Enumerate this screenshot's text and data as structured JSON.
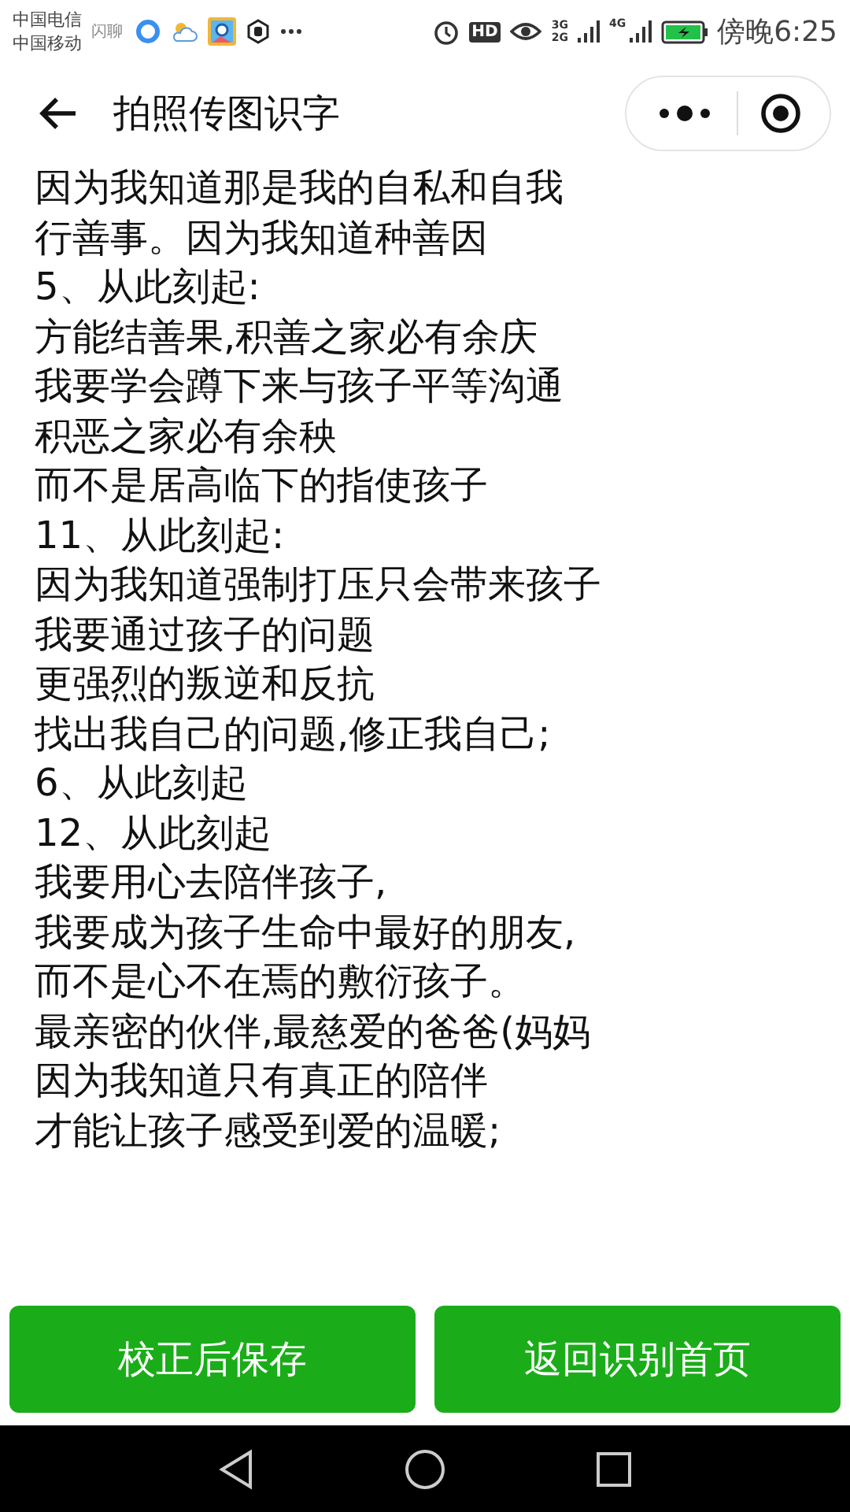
{
  "status_bar": {
    "carriers": [
      "中国电信",
      "中国移动"
    ],
    "app_label": "闪聊",
    "network_labels": [
      "3G",
      "2G",
      "4G"
    ],
    "hd": "HD",
    "time": "傍晚6:25"
  },
  "nav": {
    "title": "拍照传图识字"
  },
  "lines": [
    "因为我知道那是我的自私和自我",
    "行善事。因为我知道种善因",
    "5、从此刻起:",
    "方能结善果,积善之家必有余庆",
    "我要学会蹲下来与孩子平等沟通",
    "积恶之家必有余秧",
    "而不是居高临下的指使孩子",
    "11、从此刻起:",
    "因为我知道强制打压只会带来孩子",
    "我要通过孩子的问题",
    "更强烈的叛逆和反抗",
    "找出我自己的问题,修正我自己;",
    "6、从此刻起",
    "12、从此刻起",
    "我要用心去陪伴孩子,",
    "我要成为孩子生命中最好的朋友,",
    "而不是心不在焉的敷衍孩子。",
    "最亲密的伙伴,最慈爱的爸爸(妈妈",
    "因为我知道只有真正的陪伴",
    "才能让孩子感受到爱的温暖;"
  ],
  "buttons": [
    "校正后保存",
    "返回识别首页"
  ]
}
